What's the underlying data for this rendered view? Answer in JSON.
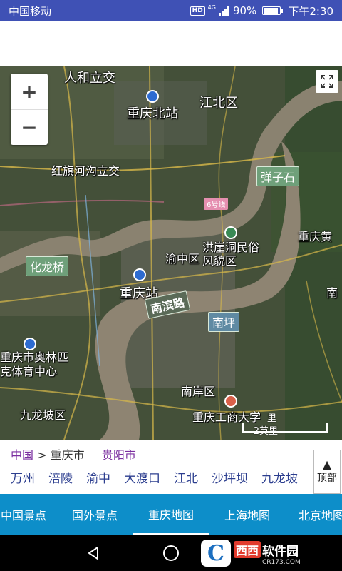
{
  "status_bar": {
    "carrier": "中国移动",
    "hd": "HD",
    "net": "4G",
    "battery_text": "90%",
    "battery_level": 0.9,
    "time": "下午2:30"
  },
  "map": {
    "labels": {
      "renhe": "人和立交",
      "chongqing_north": "重庆北站",
      "jiangbei": "江北区",
      "hongqi": "红旗河沟立交",
      "danzishi": "弹子石",
      "metro6": "6号线",
      "chongqing_huang": "重庆黄",
      "hongya": "洪崖洞民俗风貌区",
      "hualong": "化龙桥",
      "yuzhong": "渝中区",
      "chongqing_station": "重庆站",
      "nanbin": "南滨路",
      "nan_edge": "南",
      "nanping": "南坪",
      "olympic": "重庆市奥林匹克体育中心",
      "jiulongpo": "九龙坡区",
      "nanan": "南岸区",
      "ctbu": "重庆工商大学",
      "scale_top": "里",
      "scale": "2英里"
    },
    "zoom_in": "+",
    "zoom_out": "−"
  },
  "breadcrumb": {
    "china": "中国",
    "sep": ">",
    "current": "重庆市",
    "guiyang": "贵阳市"
  },
  "cities": [
    "万州",
    "涪陵",
    "渝中",
    "大渡口",
    "江北",
    "沙坪坝",
    "九龙坡"
  ],
  "top_button": {
    "arrow": "▲",
    "label": "顶部"
  },
  "tabs": [
    {
      "label": "中国景点"
    },
    {
      "label": "国外景点"
    },
    {
      "label": "重庆地图"
    },
    {
      "label": "上海地图"
    },
    {
      "label": "北京地图"
    }
  ],
  "watermark": {
    "logo": "C",
    "red1": "西西",
    "white": "软件园",
    "url": "CR173.COM"
  },
  "colors": {
    "status": "#3f51b5",
    "tab_bar": "#0d8ec9",
    "link": "#2c3e8f"
  }
}
